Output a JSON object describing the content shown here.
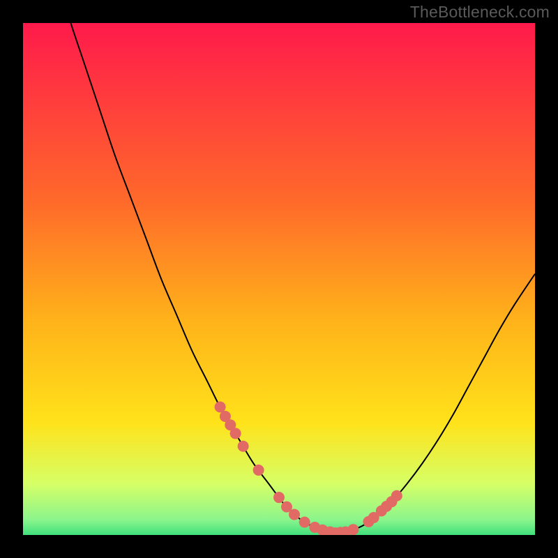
{
  "watermark": "TheBottleneck.com",
  "colors": {
    "gradient_top": "#ff1a4b",
    "gradient_mid1": "#ff8a1e",
    "gradient_mid2": "#ffe21a",
    "gradient_low": "#d6ff66",
    "gradient_bottom": "#40e07d",
    "curve": "#000000",
    "dot": "#e26a64",
    "plot_border": "#000000"
  },
  "chart_data": {
    "type": "line",
    "title": "",
    "xlabel": "",
    "ylabel": "",
    "xlim": [
      0,
      100
    ],
    "ylim": [
      0,
      100
    ],
    "x": [
      0,
      3,
      6,
      9,
      12,
      15,
      18,
      21,
      24,
      27,
      30,
      33,
      36,
      39,
      42,
      45,
      48,
      51,
      53,
      55,
      57,
      59,
      61,
      63,
      65,
      67,
      69,
      72,
      75,
      78,
      81,
      84,
      87,
      90,
      93,
      96,
      100
    ],
    "values": [
      131,
      121,
      111,
      101,
      92,
      83,
      74,
      66,
      58,
      50,
      43,
      36,
      30,
      24,
      19,
      14,
      10,
      6,
      4,
      2.5,
      1.5,
      0.8,
      0.4,
      0.6,
      1.2,
      2.2,
      3.8,
      6.5,
      10,
      14,
      18.5,
      23.5,
      29,
      34.5,
      40,
      45,
      51
    ],
    "note": "Values above 100 are clipped at the top edge; the curve reaches bottom ~0 between x≈58 and x≈63.",
    "highlight_dots_x": [
      38.5,
      39.5,
      40.5,
      41.5,
      43,
      46,
      50,
      51.5,
      53,
      55,
      57,
      58.5,
      60,
      61,
      62,
      63,
      64.5,
      67.5,
      68.5,
      70,
      71,
      72,
      73
    ],
    "highlight_dots_note": "Dots lie on the curve; y is derived from the curve value at that x."
  }
}
